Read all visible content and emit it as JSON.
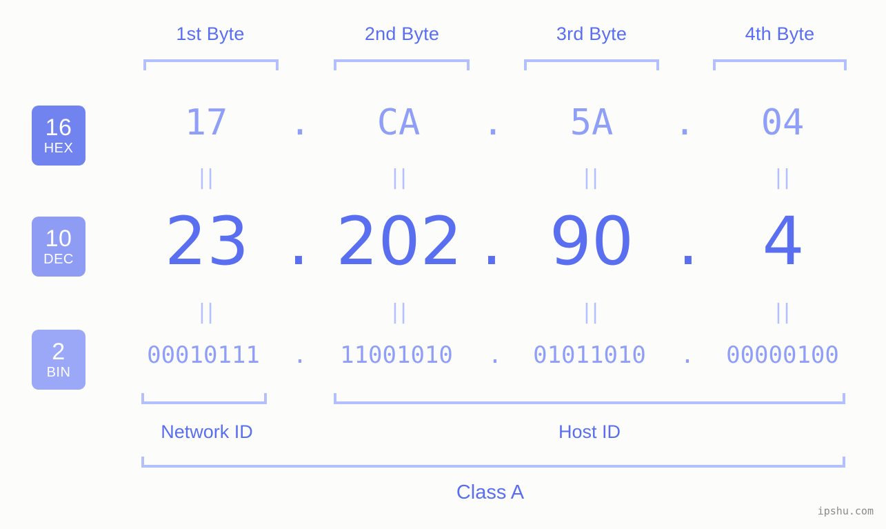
{
  "background_color": "#fcfdfa",
  "colors": {
    "accent_strong": "#5a6ef0",
    "accent_light": "#8f9ef7",
    "bracket": "#b4c0fb",
    "badge_hex": "#7183ef",
    "badge_dec": "#8e9cf4",
    "badge_bin": "#9aa8f7",
    "watermark": "#8a8a8a"
  },
  "byte_headers": [
    {
      "label": "1st Byte"
    },
    {
      "label": "2nd Byte"
    },
    {
      "label": "3rd Byte"
    },
    {
      "label": "4th Byte"
    }
  ],
  "bases": [
    {
      "number": "16",
      "name": "HEX"
    },
    {
      "number": "10",
      "name": "DEC"
    },
    {
      "number": "2",
      "name": "BIN"
    }
  ],
  "rows": {
    "hex": {
      "base_number": "16",
      "base_name": "HEX",
      "values": [
        "17",
        "CA",
        "5A",
        "04"
      ],
      "separator": "."
    },
    "dec": {
      "base_number": "10",
      "base_name": "DEC",
      "values": [
        "23",
        "202",
        "90",
        "4"
      ],
      "separator": "."
    },
    "bin": {
      "base_number": "2",
      "base_name": "BIN",
      "values": [
        "00010111",
        "11001010",
        "01011010",
        "00000100"
      ],
      "separator": "."
    }
  },
  "equality_marks": {
    "glyph": "||",
    "count_per_row": 4
  },
  "sections": {
    "network_id": {
      "label": "Network ID"
    },
    "host_id": {
      "label": "Host ID"
    },
    "class": {
      "label": "Class A"
    }
  },
  "watermark": {
    "text": "ipshu.com"
  }
}
